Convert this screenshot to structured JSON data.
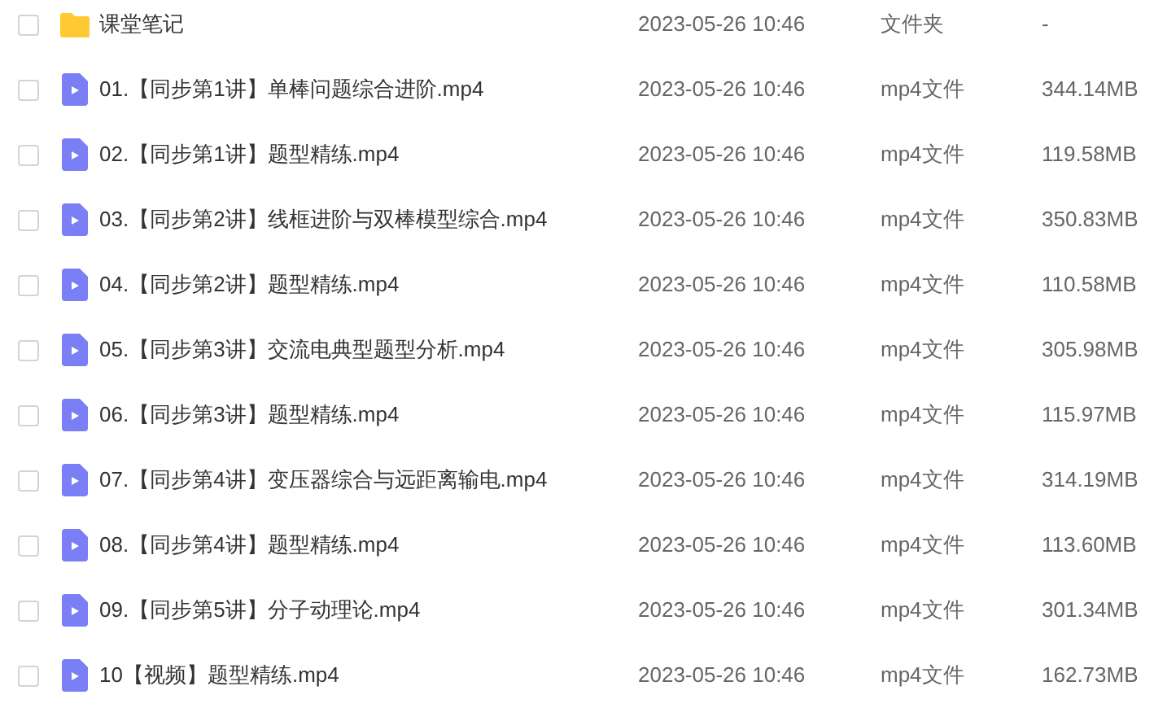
{
  "files": [
    {
      "kind": "folder",
      "checked": false,
      "name": "课堂笔记",
      "modified": "2023-05-26 10:46",
      "type": "文件夹",
      "size": "-"
    },
    {
      "kind": "video",
      "checked": false,
      "name": "01.【同步第1讲】单棒问题综合进阶.mp4",
      "modified": "2023-05-26 10:46",
      "type": "mp4文件",
      "size": "344.14MB"
    },
    {
      "kind": "video",
      "checked": false,
      "name": "02.【同步第1讲】题型精练.mp4",
      "modified": "2023-05-26 10:46",
      "type": "mp4文件",
      "size": "119.58MB"
    },
    {
      "kind": "video",
      "checked": false,
      "name": "03.【同步第2讲】线框进阶与双棒模型综合.mp4",
      "modified": "2023-05-26 10:46",
      "type": "mp4文件",
      "size": "350.83MB"
    },
    {
      "kind": "video",
      "checked": false,
      "name": "04.【同步第2讲】题型精练.mp4",
      "modified": "2023-05-26 10:46",
      "type": "mp4文件",
      "size": "110.58MB"
    },
    {
      "kind": "video",
      "checked": false,
      "name": "05.【同步第3讲】交流电典型题型分析.mp4",
      "modified": "2023-05-26 10:46",
      "type": "mp4文件",
      "size": "305.98MB"
    },
    {
      "kind": "video",
      "checked": false,
      "name": "06.【同步第3讲】题型精练.mp4",
      "modified": "2023-05-26 10:46",
      "type": "mp4文件",
      "size": "115.97MB"
    },
    {
      "kind": "video",
      "checked": false,
      "name": "07.【同步第4讲】变压器综合与远距离输电.mp4",
      "modified": "2023-05-26 10:46",
      "type": "mp4文件",
      "size": "314.19MB"
    },
    {
      "kind": "video",
      "checked": false,
      "name": "08.【同步第4讲】题型精练.mp4",
      "modified": "2023-05-26 10:46",
      "type": "mp4文件",
      "size": "113.60MB"
    },
    {
      "kind": "video",
      "checked": false,
      "name": "09.【同步第5讲】分子动理论.mp4",
      "modified": "2023-05-26 10:46",
      "type": "mp4文件",
      "size": "301.34MB"
    },
    {
      "kind": "video",
      "checked": false,
      "name": "10【视频】题型精练.mp4",
      "modified": "2023-05-26 10:46",
      "type": "mp4文件",
      "size": "162.73MB"
    }
  ]
}
